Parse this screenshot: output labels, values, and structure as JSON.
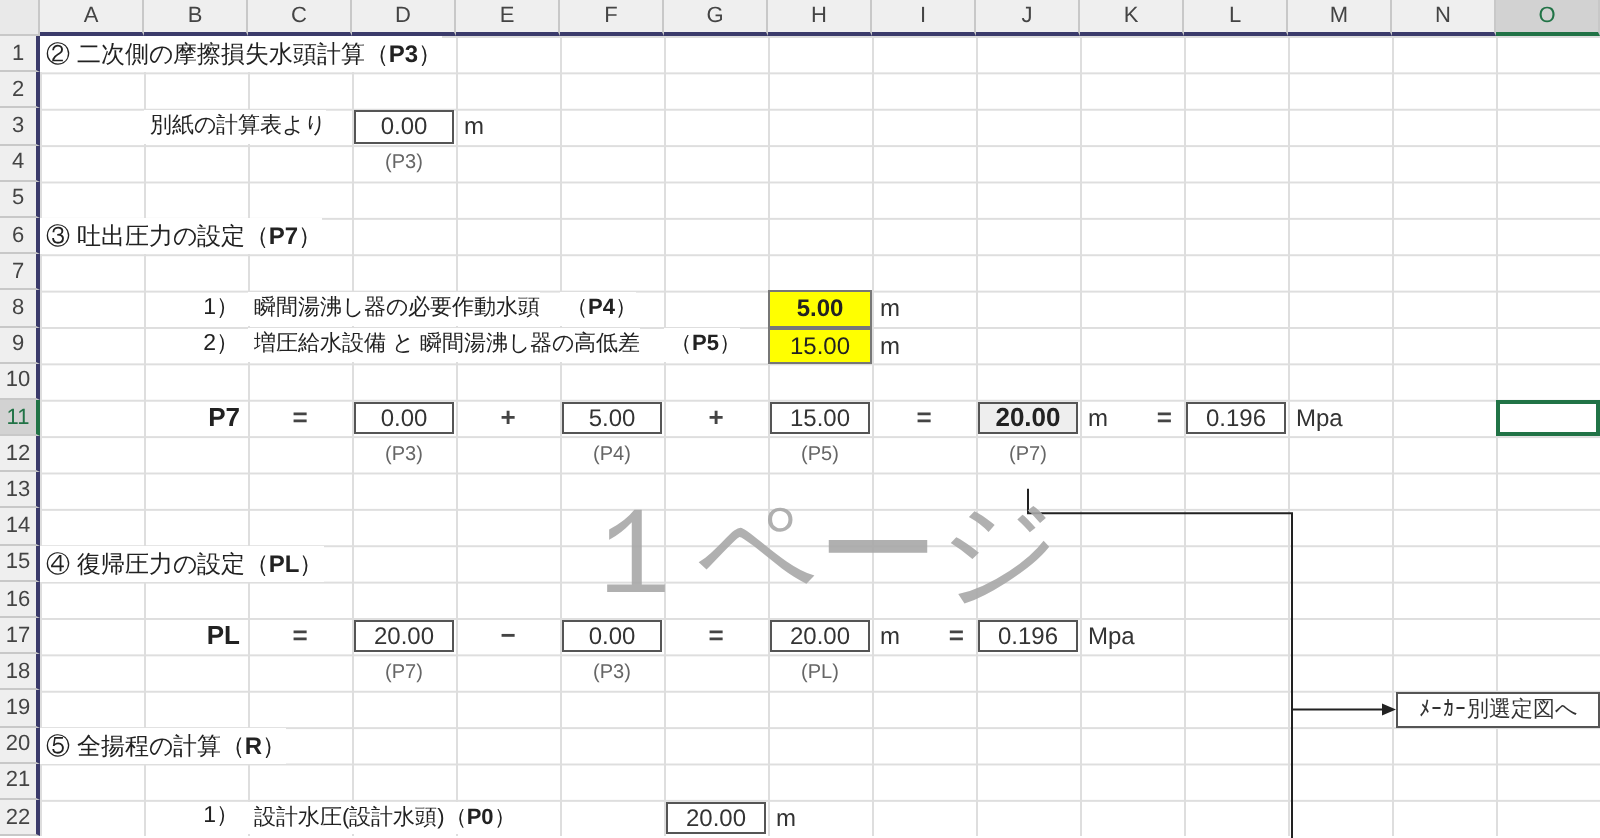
{
  "columns": [
    {
      "label": "A",
      "selected": false
    },
    {
      "label": "B",
      "selected": false
    },
    {
      "label": "C",
      "selected": false
    },
    {
      "label": "D",
      "selected": false
    },
    {
      "label": "E",
      "selected": false
    },
    {
      "label": "F",
      "selected": false
    },
    {
      "label": "G",
      "selected": false
    },
    {
      "label": "H",
      "selected": false
    },
    {
      "label": "I",
      "selected": false
    },
    {
      "label": "J",
      "selected": false
    },
    {
      "label": "K",
      "selected": false
    },
    {
      "label": "L",
      "selected": false
    },
    {
      "label": "M",
      "selected": false
    },
    {
      "label": "N",
      "selected": false
    },
    {
      "label": "O",
      "selected": true
    }
  ],
  "rows": [
    {
      "label": "1",
      "selected": false,
      "cells": {
        "A": [
          {
            "kind": "heading",
            "text": "② 二次側の摩擦損失水頭計算（**P3**）"
          }
        ]
      }
    },
    {
      "label": "2",
      "selected": false
    },
    {
      "label": "3",
      "selected": false,
      "cells": {
        "B": [
          {
            "kind": "text",
            "text": "別紙の計算表より"
          }
        ],
        "D": [
          {
            "kind": "box",
            "text": "0.00"
          }
        ],
        "E": [
          {
            "kind": "unit",
            "text": "m"
          }
        ]
      }
    },
    {
      "label": "4",
      "selected": false,
      "cells": {
        "D": [
          {
            "kind": "note",
            "text": "(P3)"
          }
        ]
      }
    },
    {
      "label": "5",
      "selected": false
    },
    {
      "label": "6",
      "selected": false,
      "cells": {
        "A": [
          {
            "kind": "heading",
            "text": "③ 吐出圧力の設定（**P7**）"
          }
        ]
      }
    },
    {
      "label": "7",
      "selected": false
    },
    {
      "label": "8",
      "selected": false,
      "cells": {
        "B": [
          {
            "kind": "right",
            "text": "1）"
          }
        ],
        "C": [
          {
            "kind": "text",
            "text": "瞬間湯沸し器の必要作動水頭"
          }
        ],
        "F": [
          {
            "kind": "text",
            "text": "（**P4**）"
          }
        ],
        "H": [
          {
            "kind": "yellow-bold",
            "text": "5.00"
          }
        ],
        "I": [
          {
            "kind": "unit",
            "text": "m"
          }
        ]
      }
    },
    {
      "label": "9",
      "selected": false,
      "cells": {
        "B": [
          {
            "kind": "right",
            "text": "2）"
          }
        ],
        "C": [
          {
            "kind": "text",
            "text": "増圧給水設備 と 瞬間湯沸し器の高低差"
          }
        ],
        "G": [
          {
            "kind": "text",
            "text": "（**P5**）"
          }
        ],
        "H": [
          {
            "kind": "yellow",
            "text": "15.00"
          }
        ],
        "I": [
          {
            "kind": "unit",
            "text": "m"
          }
        ]
      }
    },
    {
      "label": "10",
      "selected": false
    },
    {
      "label": "11",
      "selected": true,
      "cells": {
        "B": [
          {
            "kind": "var",
            "text": "P7"
          }
        ],
        "C": [
          {
            "kind": "op",
            "text": "="
          }
        ],
        "D": [
          {
            "kind": "box",
            "text": "0.00"
          }
        ],
        "E": [
          {
            "kind": "op",
            "text": "+"
          }
        ],
        "F": [
          {
            "kind": "box",
            "text": "5.00"
          }
        ],
        "G": [
          {
            "kind": "op",
            "text": "+"
          }
        ],
        "H": [
          {
            "kind": "box",
            "text": "15.00"
          }
        ],
        "I": [
          {
            "kind": "op",
            "text": "="
          }
        ],
        "J": [
          {
            "kind": "result",
            "text": "20.00"
          }
        ],
        "K": [
          {
            "kind": "unit",
            "text": "m"
          },
          {
            "kind": "op-right",
            "text": "="
          }
        ],
        "L": [
          {
            "kind": "box",
            "text": "0.196"
          }
        ],
        "M": [
          {
            "kind": "unit",
            "text": "Mpa"
          }
        ]
      }
    },
    {
      "label": "12",
      "selected": false,
      "cells": {
        "D": [
          {
            "kind": "note",
            "text": "(P3)"
          }
        ],
        "F": [
          {
            "kind": "note",
            "text": "(P4)"
          }
        ],
        "H": [
          {
            "kind": "note",
            "text": "(P5)"
          }
        ],
        "J": [
          {
            "kind": "note",
            "text": "(P7)"
          }
        ]
      }
    },
    {
      "label": "13",
      "selected": false
    },
    {
      "label": "14",
      "selected": false
    },
    {
      "label": "15",
      "selected": false,
      "cells": {
        "A": [
          {
            "kind": "heading",
            "text": "④ 復帰圧力の設定（**PL**）"
          }
        ]
      }
    },
    {
      "label": "16",
      "selected": false
    },
    {
      "label": "17",
      "selected": false,
      "cells": {
        "B": [
          {
            "kind": "var",
            "text": "PL"
          }
        ],
        "C": [
          {
            "kind": "op",
            "text": "="
          }
        ],
        "D": [
          {
            "kind": "box",
            "text": "20.00"
          }
        ],
        "E": [
          {
            "kind": "op",
            "text": "−"
          }
        ],
        "F": [
          {
            "kind": "box",
            "text": "0.00"
          }
        ],
        "G": [
          {
            "kind": "op",
            "text": "="
          }
        ],
        "H": [
          {
            "kind": "box",
            "text": "20.00"
          }
        ],
        "I": [
          {
            "kind": "unit",
            "text": "m"
          },
          {
            "kind": "op-right",
            "text": "="
          }
        ],
        "J": [
          {
            "kind": "box",
            "text": "0.196"
          }
        ],
        "K": [
          {
            "kind": "unit",
            "text": "Mpa"
          }
        ]
      }
    },
    {
      "label": "18",
      "selected": false,
      "cells": {
        "D": [
          {
            "kind": "note",
            "text": "(P7)"
          }
        ],
        "F": [
          {
            "kind": "note",
            "text": "(P3)"
          }
        ],
        "H": [
          {
            "kind": "note",
            "text": "(PL)"
          }
        ]
      }
    },
    {
      "label": "19",
      "selected": false,
      "cells": {
        "N": [
          {
            "kind": "link-box",
            "text": "ﾒｰｶｰ別選定図へ"
          }
        ]
      }
    },
    {
      "label": "20",
      "selected": false,
      "cells": {
        "A": [
          {
            "kind": "heading",
            "text": "⑤ 全揚程の計算（**R**）"
          }
        ]
      }
    },
    {
      "label": "21",
      "selected": false
    },
    {
      "label": "22",
      "selected": false,
      "cells": {
        "B": [
          {
            "kind": "right",
            "text": "1）"
          }
        ],
        "C": [
          {
            "kind": "text",
            "text": "設計水圧(設計水頭)（**P0**）"
          }
        ],
        "G": [
          {
            "kind": "box",
            "text": "20.00"
          }
        ],
        "H": [
          {
            "kind": "unit",
            "text": "m"
          }
        ]
      }
    }
  ],
  "page_label": "１ページ"
}
